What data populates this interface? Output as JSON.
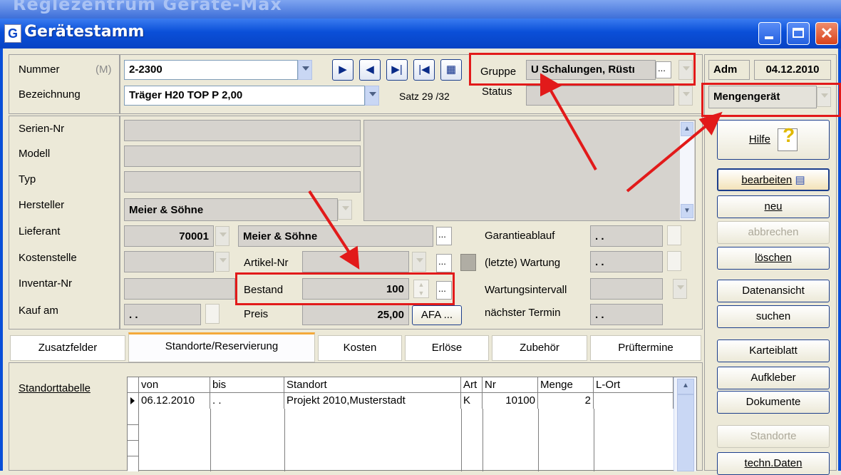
{
  "background_window": {
    "title": "Reglezentrum Geräte-Max"
  },
  "window": {
    "title": "Gerätestamm",
    "icon_letter": "G"
  },
  "header": {
    "nummer_label": "Nummer",
    "nummer_badge": "(M)",
    "nummer_value": "2-2300",
    "bezeichnung_label": "Bezeichnung",
    "bezeichnung_value": "Träger  H20 TOP  P 2,00",
    "satz": "Satz 29 /32",
    "gruppe_label": "Gruppe",
    "gruppe_value": "U Schalungen, Rüstı",
    "status_label": "Status",
    "user": "Adm",
    "date": "04.12.2010",
    "geraet_typ": "Mengengerät"
  },
  "fields": {
    "serien_nr_label": "Serien-Nr",
    "modell_label": "Modell",
    "typ_label": "Typ",
    "hersteller_label": "Hersteller",
    "hersteller_value": "Meier & Söhne",
    "lieferant_label": "Lieferant",
    "lieferant_nr": "70001",
    "lieferant_name": "Meier & Söhne",
    "kostenstelle_label": "Kostenstelle",
    "artikel_nr_label": "Artikel-Nr",
    "inventar_nr_label": "Inventar-Nr",
    "bestand_label": "Bestand",
    "bestand_value": "100",
    "kauf_am_label": "Kauf am",
    "kauf_am_value": ". .",
    "preis_label": "Preis",
    "preis_value": "25,00",
    "afa_button": "AFA ...",
    "garantieablauf_label": "Garantieablauf",
    "garantieablauf_value": ". .",
    "letzte_wartung_label": "(letzte) Wartung",
    "letzte_wartung_value": ". .",
    "wartungsintervall_label": "Wartungsintervall",
    "naechster_termin_label": "nächster Termin",
    "naechster_termin_value": ". .",
    "ellipsis": "..."
  },
  "sidebar": {
    "hilfe": "Hilfe",
    "bearbeiten": "bearbeiten",
    "neu": "neu",
    "abbrechen": "abbrechen",
    "loeschen": "löschen",
    "datenansicht": "Datenansicht",
    "suchen": "suchen",
    "karteiblatt": "Karteiblatt",
    "aufkleber": "Aufkleber",
    "dokumente": "Dokumente",
    "standorte": "Standorte",
    "techn_daten": "techn.Daten"
  },
  "tabs": [
    "Zusatzfelder",
    "Standorte/Reservierung",
    "Kosten",
    "Erlöse",
    "Zubehör",
    "Prüftermine"
  ],
  "standort": {
    "label": "Standorttabelle",
    "columns": [
      "von",
      "bis",
      "Standort",
      "Art",
      "Nr",
      "Menge",
      "L-Ort"
    ],
    "rows": [
      {
        "von": "06.12.2010",
        "bis": ". .",
        "standort": "Projekt 2010,Musterstadt",
        "art": "K",
        "nr": "10100",
        "menge": "2",
        "lort": ""
      }
    ]
  },
  "colors": {
    "title_blue": "#0a4fd8",
    "highlight_red": "#e21a1a",
    "window_bg": "#ece9d8"
  }
}
